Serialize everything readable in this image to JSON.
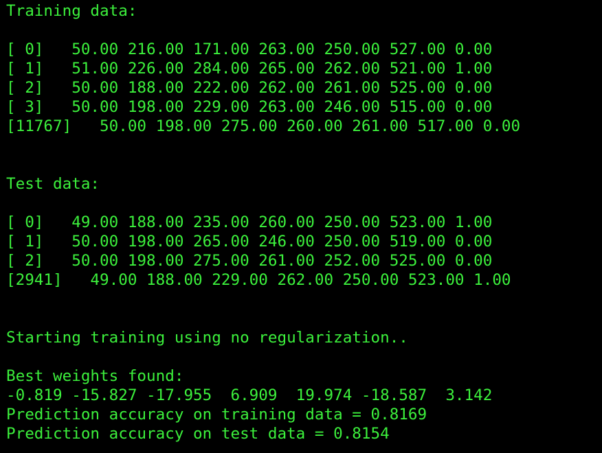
{
  "terminal": {
    "lines": [
      "Training data:",
      "",
      "[ 0]   50.00 216.00 171.00 263.00 250.00 527.00 0.00",
      "[ 1]   51.00 226.00 284.00 265.00 262.00 521.00 1.00",
      "[ 2]   50.00 188.00 222.00 262.00 261.00 525.00 0.00",
      "[ 3]   50.00 198.00 229.00 263.00 246.00 515.00 0.00",
      "[11767]   50.00 198.00 275.00 260.00 261.00 517.00 0.00",
      "",
      "",
      "Test data:",
      "",
      "[ 0]   49.00 188.00 235.00 260.00 250.00 523.00 1.00",
      "[ 1]   50.00 198.00 265.00 246.00 250.00 519.00 0.00",
      "[ 2]   50.00 198.00 275.00 261.00 252.00 525.00 0.00",
      "[2941]   49.00 188.00 229.00 262.00 250.00 523.00 1.00",
      "",
      "",
      "Starting training using no regularization..",
      "",
      "Best weights found:",
      "-0.819 -15.827 -17.955  6.909  19.974 -18.587  3.142",
      "Prediction accuracy on training data = 0.8169",
      "Prediction accuracy on test data = 0.8154"
    ]
  },
  "colors": {
    "background": "#000000",
    "text": "#3cf03c"
  }
}
